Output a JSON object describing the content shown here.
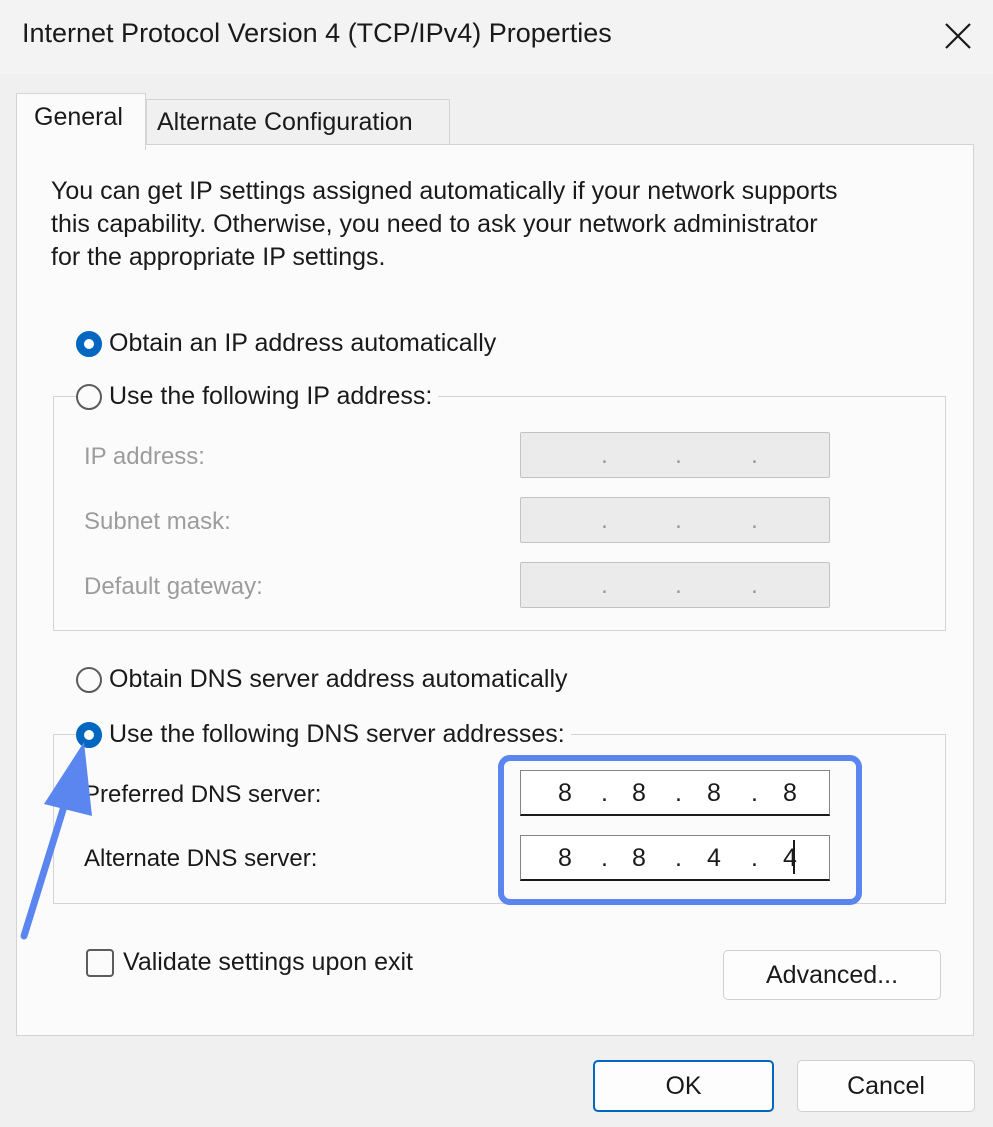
{
  "window": {
    "title": "Internet Protocol Version 4 (TCP/IPv4) Properties",
    "close_icon": "close-icon"
  },
  "tabs": [
    {
      "label": "General",
      "active": true
    },
    {
      "label": "Alternate Configuration",
      "active": false
    }
  ],
  "intro_text": "You can get IP settings assigned automatically if your network supports\nthis capability. Otherwise, you need to ask your network administrator\nfor the appropriate IP settings.",
  "ip_section": {
    "auto_label": "Obtain an IP address automatically",
    "auto_selected": true,
    "manual_label": "Use the following IP address:",
    "manual_selected": false,
    "fields": [
      {
        "label": "IP address:",
        "value": [
          "",
          "",
          "",
          ""
        ],
        "enabled": false
      },
      {
        "label": "Subnet mask:",
        "value": [
          "",
          "",
          "",
          ""
        ],
        "enabled": false
      },
      {
        "label": "Default gateway:",
        "value": [
          "",
          "",
          "",
          ""
        ],
        "enabled": false
      }
    ]
  },
  "dns_section": {
    "auto_label": "Obtain DNS server address automatically",
    "auto_selected": false,
    "manual_label": "Use the following DNS server addresses:",
    "manual_selected": true,
    "preferred": {
      "label": "Preferred DNS server:",
      "octets": [
        "8",
        "8",
        "8",
        "8"
      ]
    },
    "alternate": {
      "label": "Alternate DNS server:",
      "octets": [
        "8",
        "8",
        "4",
        "4"
      ]
    }
  },
  "validate": {
    "label": "Validate settings upon exit",
    "checked": false
  },
  "buttons": {
    "advanced": "Advanced...",
    "ok": "OK",
    "cancel": "Cancel"
  },
  "colors": {
    "accent": "#0067c0",
    "annotation": "#5b86f0"
  }
}
